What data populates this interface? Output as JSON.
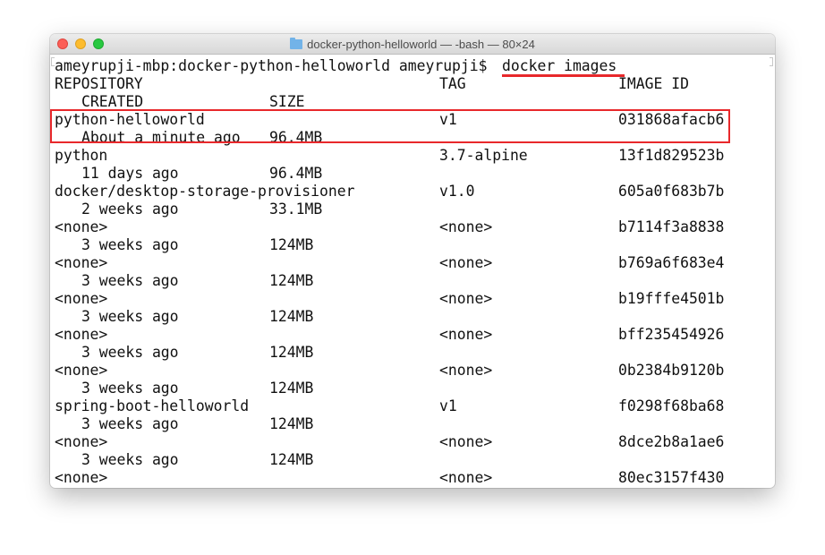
{
  "window": {
    "title": "docker-python-helloworld — -bash — 80×24"
  },
  "terminal": {
    "prompt": "ameyrupji-mbp:docker-python-helloworld ameyrupji$ ",
    "command": "docker images",
    "headers": {
      "repository": "REPOSITORY",
      "tag": "TAG",
      "image_id": "IMAGE ID",
      "created": "CREATED",
      "size": "SIZE"
    },
    "rows": [
      {
        "repository": "python-helloworld",
        "tag": "v1",
        "image_id": "031868afacb6",
        "created": "About a minute ago",
        "size": "96.4MB"
      },
      {
        "repository": "python",
        "tag": "3.7-alpine",
        "image_id": "13f1d829523b",
        "created": "11 days ago",
        "size": "96.4MB"
      },
      {
        "repository": "docker/desktop-storage-provisioner",
        "tag": "v1.0",
        "image_id": "605a0f683b7b",
        "created": "2 weeks ago",
        "size": "33.1MB"
      },
      {
        "repository": "<none>",
        "tag": "<none>",
        "image_id": "b7114f3a8838",
        "created": "3 weeks ago",
        "size": "124MB"
      },
      {
        "repository": "<none>",
        "tag": "<none>",
        "image_id": "b769a6f683e4",
        "created": "3 weeks ago",
        "size": "124MB"
      },
      {
        "repository": "<none>",
        "tag": "<none>",
        "image_id": "b19fffe4501b",
        "created": "3 weeks ago",
        "size": "124MB"
      },
      {
        "repository": "<none>",
        "tag": "<none>",
        "image_id": "bff235454926",
        "created": "3 weeks ago",
        "size": "124MB"
      },
      {
        "repository": "<none>",
        "tag": "<none>",
        "image_id": "0b2384b9120b",
        "created": "3 weeks ago",
        "size": "124MB"
      },
      {
        "repository": "spring-boot-helloworld",
        "tag": "v1",
        "image_id": "f0298f68ba68",
        "created": "3 weeks ago",
        "size": "124MB"
      },
      {
        "repository": "<none>",
        "tag": "<none>",
        "image_id": "8dce2b8a1ae6",
        "created": "3 weeks ago",
        "size": "124MB"
      },
      {
        "repository": "<none>",
        "tag": "<none>",
        "image_id": "80ec3157f430"
      }
    ]
  },
  "annotations": {
    "color": "#e8282b",
    "highlighted_row": 0
  }
}
